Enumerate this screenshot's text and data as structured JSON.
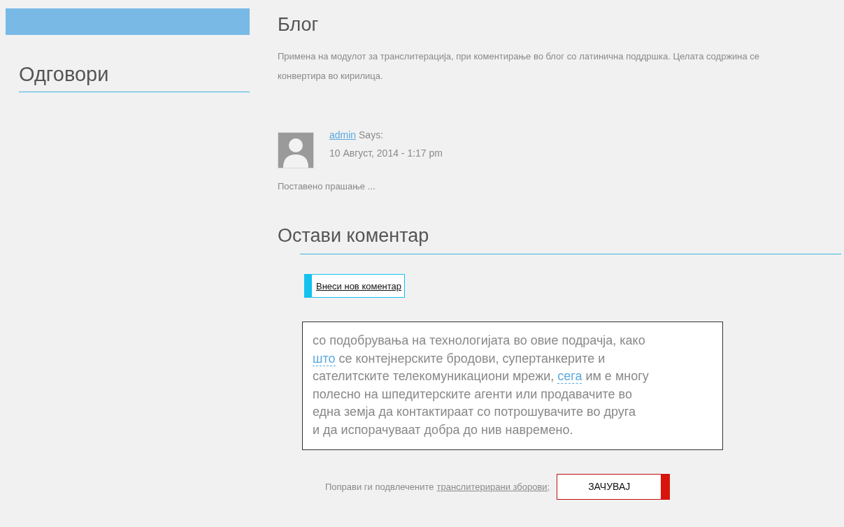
{
  "sidebar": {
    "heading": "Одговори"
  },
  "blog": {
    "title": "Блог",
    "description": "Примена на модулот за транслитерација, при коментирање во блог со латинична поддршка. Целата содржина се конвертира во кирилица."
  },
  "comment": {
    "author": "admin",
    "says": "Says:",
    "date": "10 Август, 2014 - 1:17 pm",
    "text": "Поставено прашање ..."
  },
  "reply": {
    "heading": "Остави коментар",
    "new_comment_button": "Внеси нов коментар",
    "lines": [
      [
        {
          "kind": "plain",
          "text": "со подобрувања на технологијата во овие подрачја, како"
        }
      ],
      [
        {
          "kind": "marked",
          "text": "што"
        },
        {
          "kind": "plain",
          "text": " се контејнерските бродови, супертанкерите и"
        }
      ],
      [
        {
          "kind": "plain",
          "text": "сателитските телекомуникациони мрежи, "
        },
        {
          "kind": "marked",
          "text": "сега"
        },
        {
          "kind": "plain",
          "text": " им е многу"
        }
      ],
      [
        {
          "kind": "plain",
          "text": "полесно на шпедитерските агенти или продавачите во"
        }
      ],
      [
        {
          "kind": "plain",
          "text": "една земја да контактираат со потрошувачите во друга"
        }
      ],
      [
        {
          "kind": "plain",
          "text": "и да испорачуваат добра до нив навремено."
        }
      ]
    ],
    "hint": "Поправи ги подвлечените",
    "hint_link": "транслитерирани зборови;",
    "save_button": "ЗАЧУВАЈ"
  }
}
